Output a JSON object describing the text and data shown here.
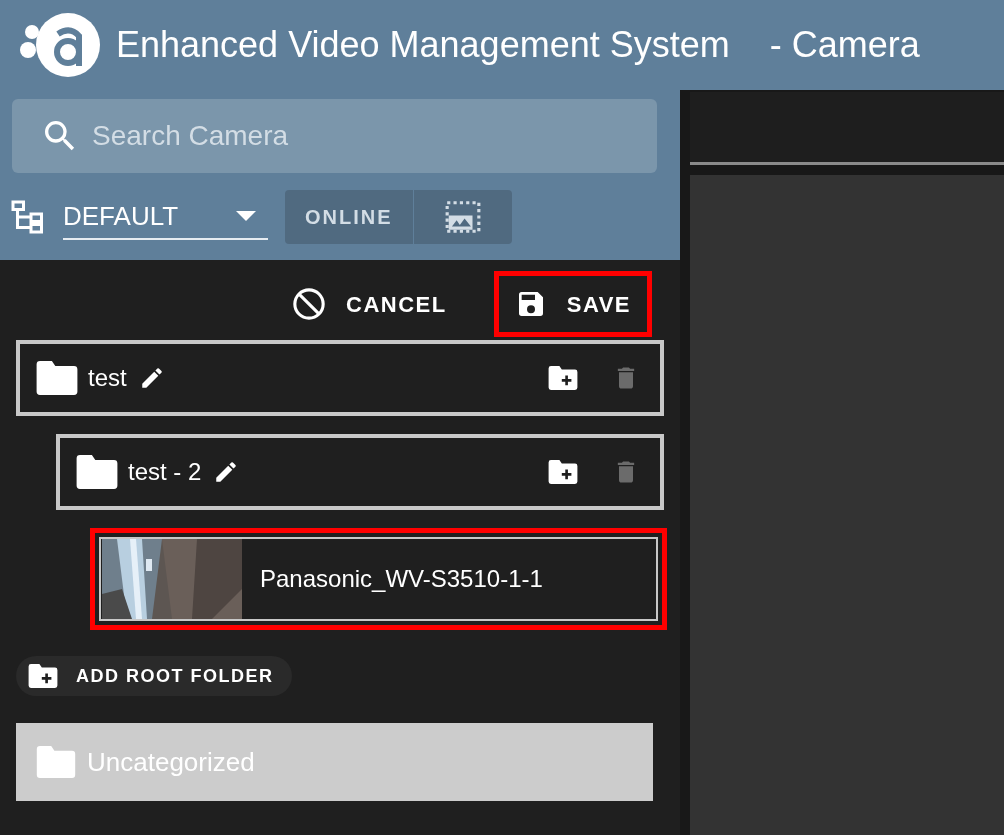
{
  "app": {
    "title": "Enhanced Video Management System",
    "page": "- Camera"
  },
  "search": {
    "placeholder": "Search Camera"
  },
  "layout_select": {
    "value": "DEFAULT"
  },
  "online_button": {
    "label": "ONLINE"
  },
  "actions": [
    {
      "kind": "cancel",
      "label": "CANCEL",
      "highlighted": false
    },
    {
      "kind": "save",
      "label": "SAVE",
      "highlighted": true
    }
  ],
  "tree": [
    {
      "kind": "folder",
      "name": "test",
      "children": [
        {
          "kind": "folder",
          "name": "test - 2",
          "children": [
            {
              "kind": "camera",
              "name": "Panasonic_WV-S3510-1-1",
              "highlighted": true
            }
          ]
        }
      ]
    }
  ],
  "add_root": {
    "label": "ADD ROOT FOLDER"
  },
  "uncategorized": {
    "name": "Uncategorized"
  }
}
